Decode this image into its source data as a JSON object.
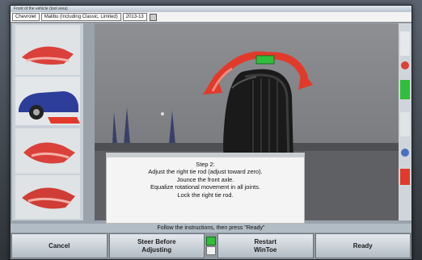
{
  "window": {
    "title": "Front of the vehicle (tool area)"
  },
  "infobar": {
    "make": "Chevrolet",
    "model": "Malibu (Including Classic, Limited)",
    "year": "2013-13"
  },
  "dialog": {
    "lines": [
      "Step 2:",
      "Adjust the right tie rod (adjust toward zero).",
      "Jounce the front axle.",
      "Equalize rotational movement in all joints.",
      "Lock the right tie rod."
    ]
  },
  "status": {
    "text": "Follow the instructions, then press \"Ready\""
  },
  "buttons": {
    "cancel": "Cancel",
    "steer_before_line1": "Steer Before",
    "steer_before_line2": "Adjusting",
    "restart_line1": "Restart",
    "restart_line2": "WinToe",
    "ready": "Ready"
  },
  "colors": {
    "accent_red": "#e23a2a",
    "accent_green": "#2fbf3a",
    "indicator_green": "#2fbf3a"
  },
  "icons": [
    "wheel-icon",
    "tie-rod-arrow-icon",
    "status-indicator-icon"
  ]
}
